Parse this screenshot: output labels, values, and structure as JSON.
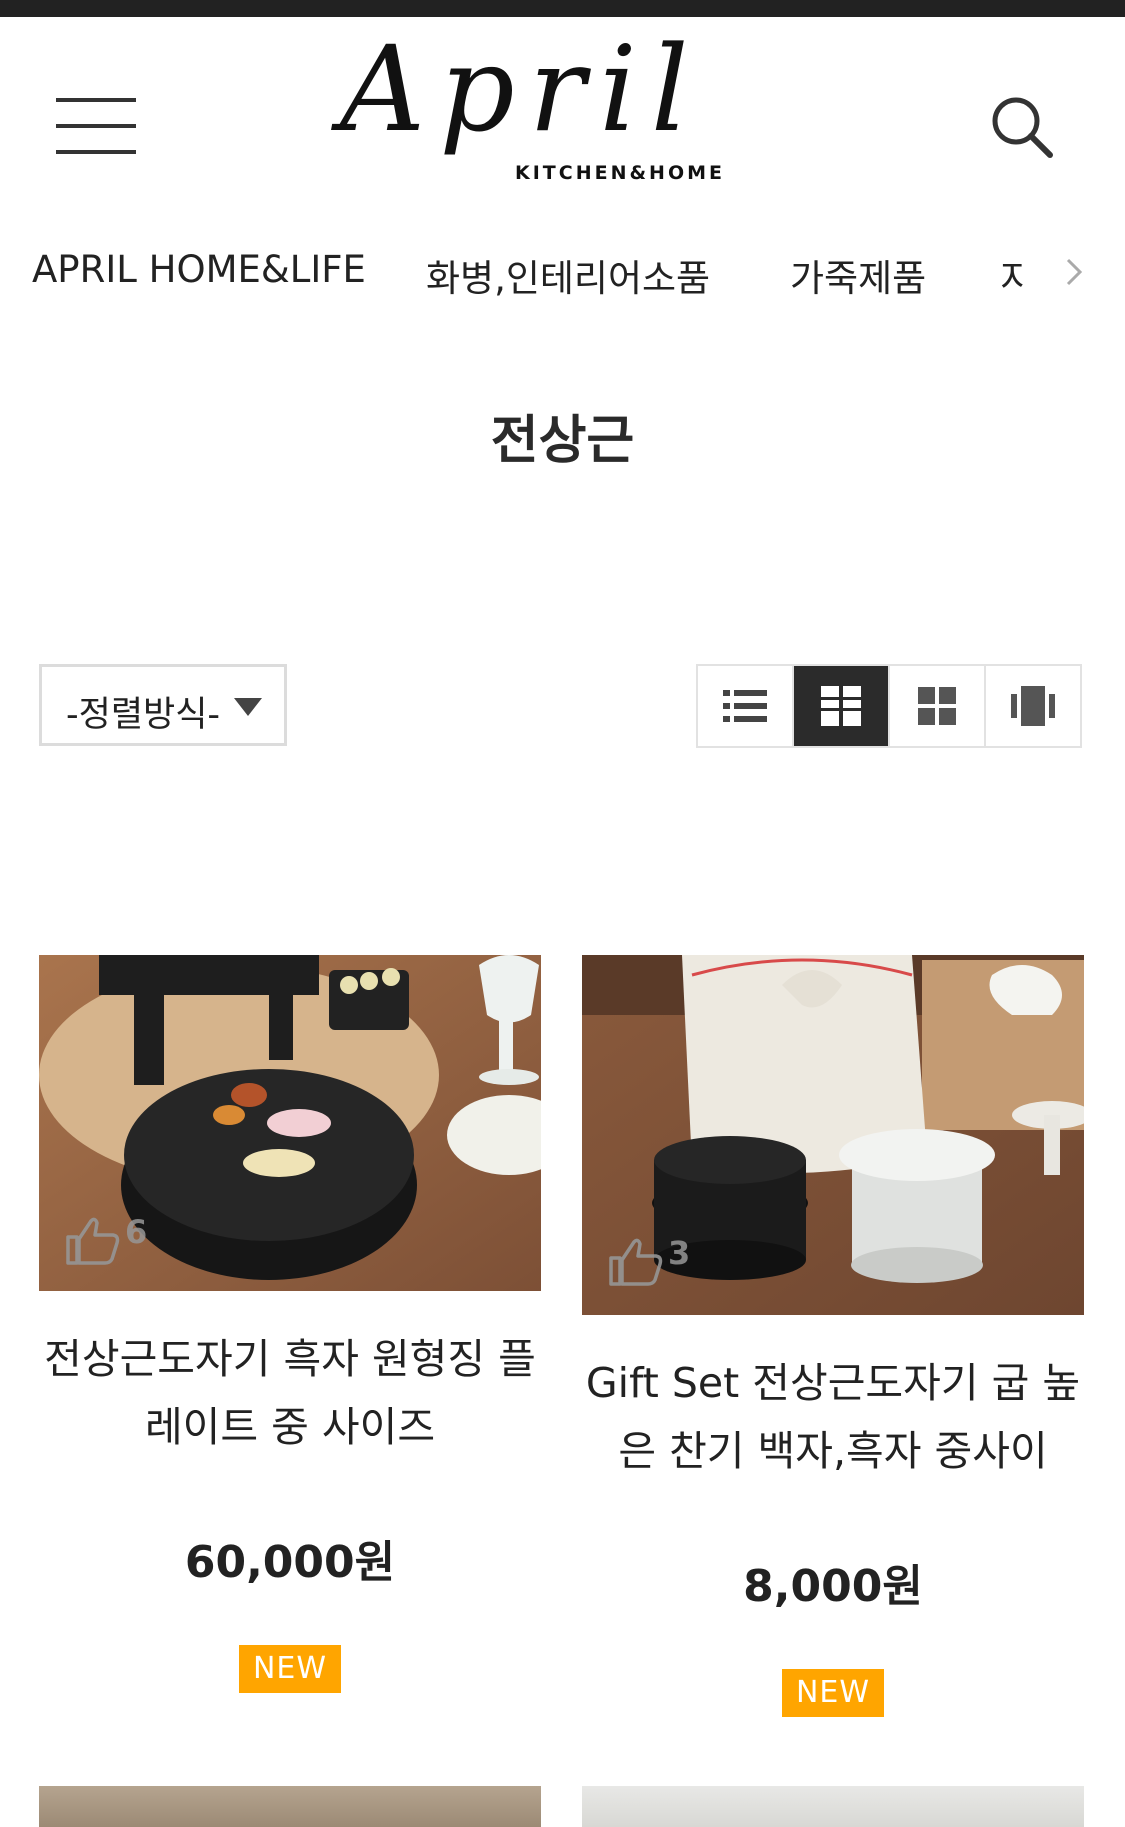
{
  "header": {
    "logo_text": "April",
    "logo_subtext": "KITCHEN&HOME"
  },
  "categories": [
    "APRIL HOME&LIFE",
    "화병,인테리어소품",
    "가죽제품",
    "지"
  ],
  "page": {
    "title": "전상근"
  },
  "sort": {
    "label": "-정렬방식-"
  },
  "view_modes": [
    "list-icon",
    "grid-2-icon",
    "grid-4-icon",
    "gallery-icon"
  ],
  "products": [
    {
      "name": "전상근도자기 흑자 원형징 플레이트 중 사이즈",
      "price": "60,000원",
      "likes": "6",
      "badge": "NEW"
    },
    {
      "name": "Gift Set 전상근도자기 굽 높은 찬기 백자,흑자 중사이",
      "price": "8,000원",
      "likes": "3",
      "badge": "NEW"
    }
  ],
  "colors": {
    "badge": "#ffa500",
    "active_view": "#2b2b2b"
  }
}
